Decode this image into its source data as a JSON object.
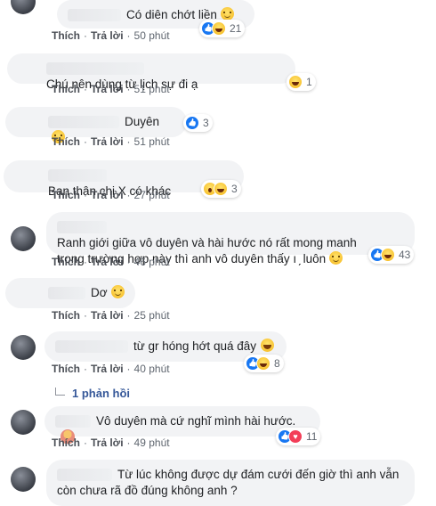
{
  "actions": {
    "like": "Thích",
    "reply": "Trả lời",
    "separator": "·"
  },
  "comments": [
    {
      "text": "Có diên chớt liền",
      "reactions": [
        "like",
        "haha"
      ],
      "count": "21",
      "time": "50 phút"
    },
    {
      "text": "Chú nên dùng từ lịch sự đi ạ",
      "reactions": [
        "haha"
      ],
      "count": "1",
      "time": "51 phút"
    },
    {
      "text": "Duyên",
      "reactions": [
        "like"
      ],
      "count": "3",
      "time": "51 phút"
    },
    {
      "text": "Bạn thân chị X có khác",
      "reactions": [
        "wow",
        "haha"
      ],
      "count": "3",
      "time": "27 phút"
    },
    {
      "text_line1": "Ranh giới giữa vô duyên và hài hước nó rất mong manh",
      "text_line2": "trong trường hợp này thì anh vô duyên thấy ı  ̗ luôn",
      "reactions": [
        "like",
        "haha"
      ],
      "count": "43",
      "time": "46 phút"
    },
    {
      "text": "Dơ",
      "time": "25 phút"
    },
    {
      "text": "từ gr hóng hớt quá đây",
      "reactions": [
        "like",
        "haha"
      ],
      "count": "8",
      "time": "40 phút",
      "replies": "1 phản hồi"
    },
    {
      "text": "Vô duyên mà cứ nghĩ mình hài hước.",
      "reactions": [
        "like",
        "love"
      ],
      "count": "11",
      "time": "49 phút"
    },
    {
      "text_line1": "Từ lúc không được dự đám cưới đến giờ thì anh vẫn",
      "text_line2": "còn chưa rã đồ đúng không anh ?"
    }
  ],
  "colors": {
    "bubble": "#f2f3f5",
    "link": "#365899",
    "meta": "#606770",
    "like": "#1877f2",
    "love": "#f33e58"
  }
}
